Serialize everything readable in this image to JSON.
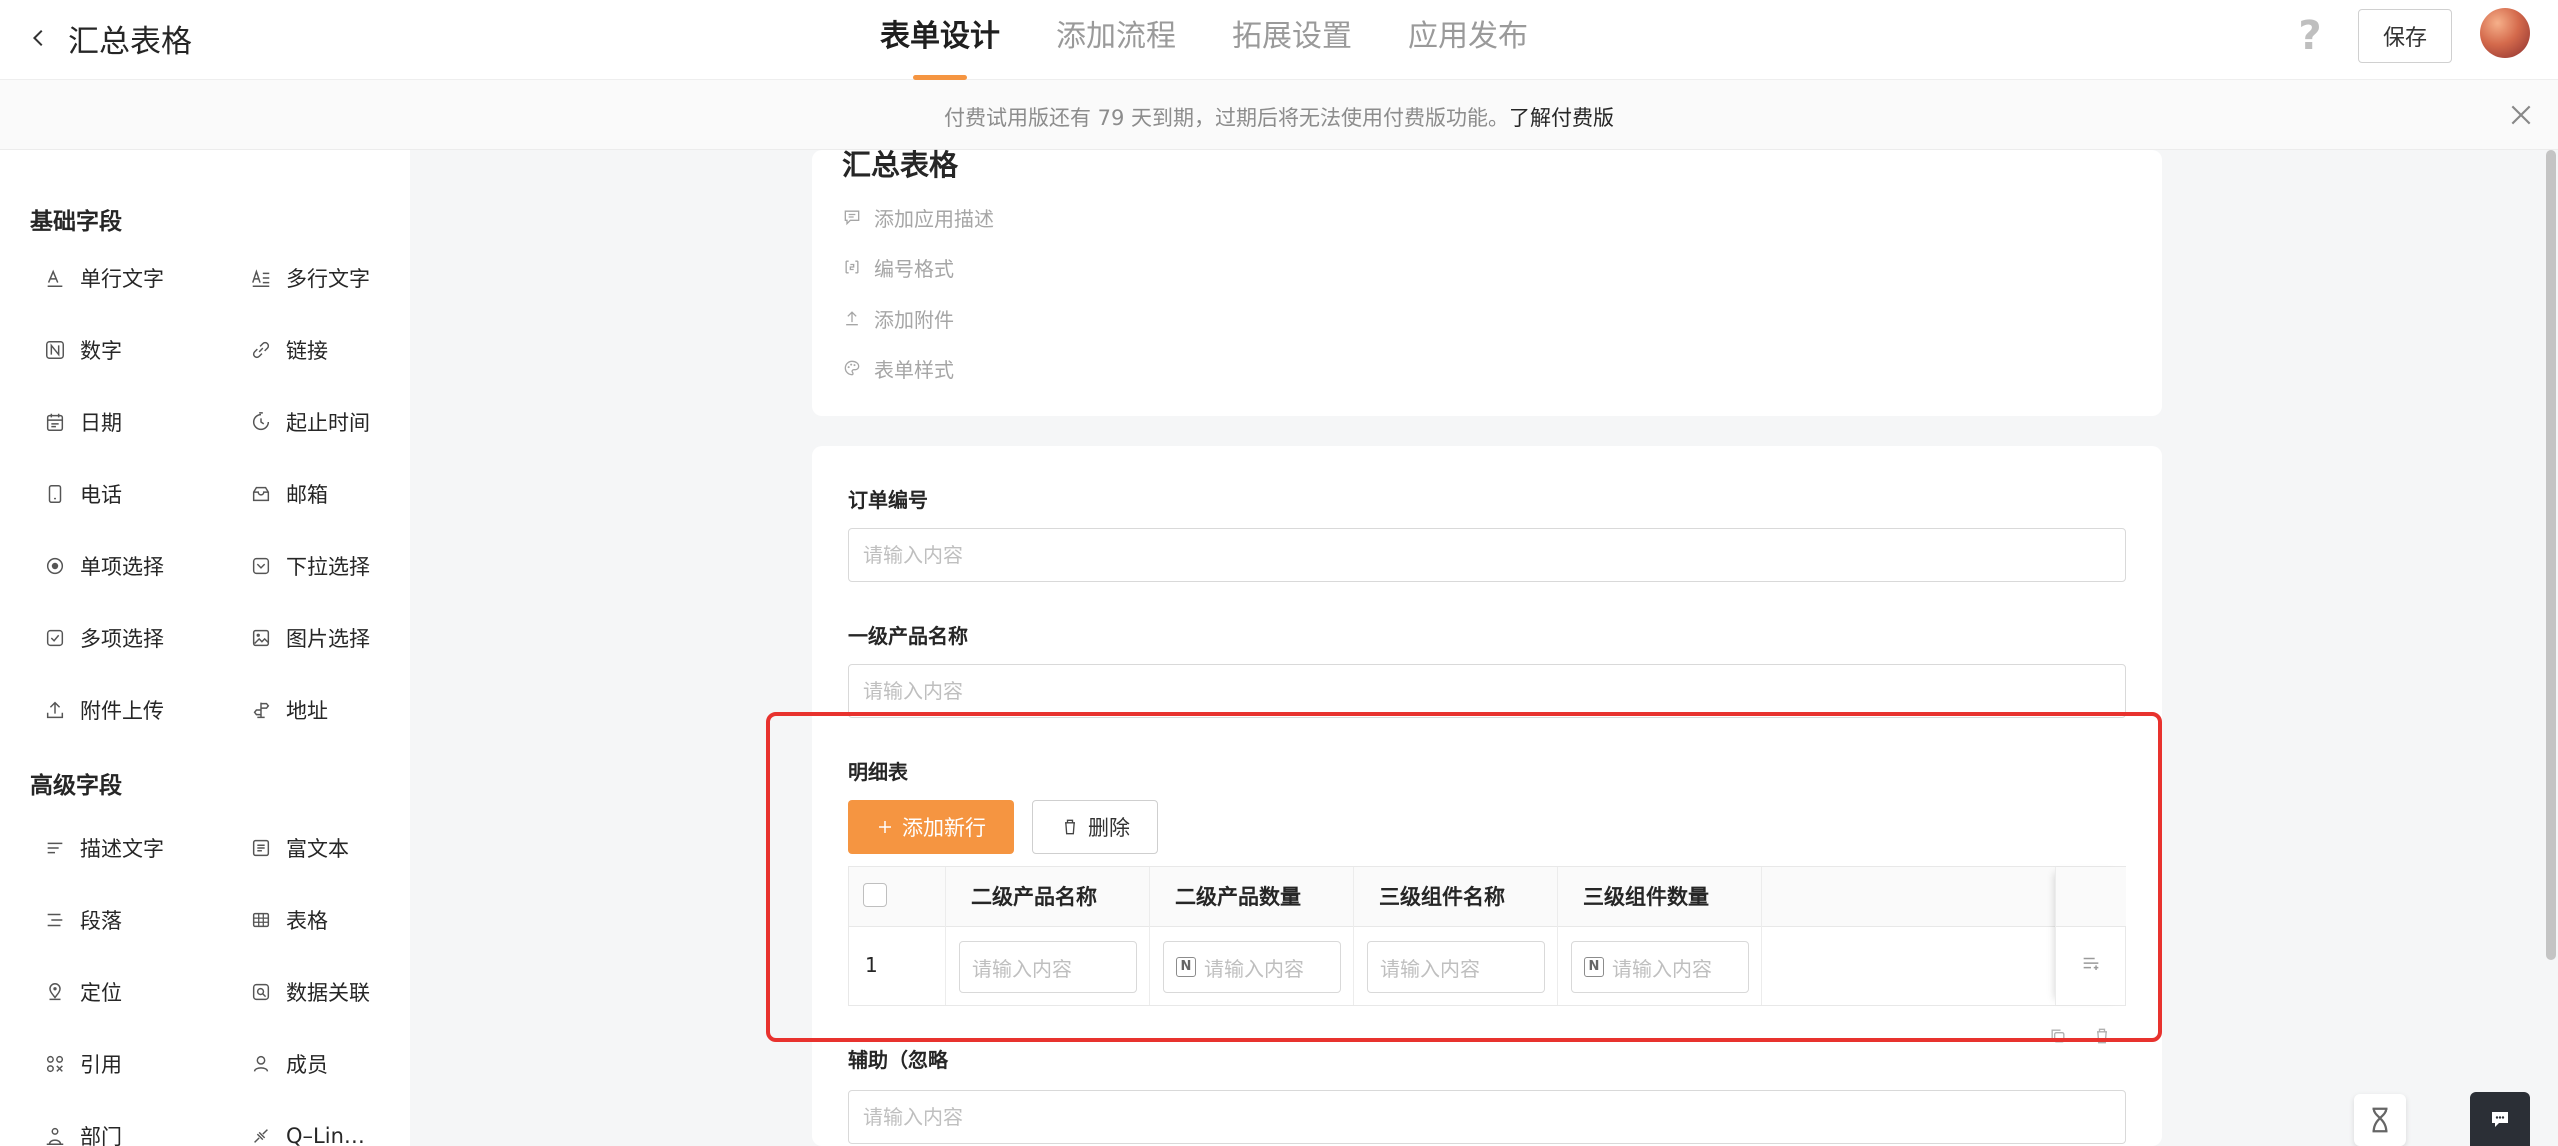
{
  "header": {
    "title": "汇总表格",
    "tabs": [
      {
        "label": "表单设计",
        "active": true
      },
      {
        "label": "添加流程",
        "active": false
      },
      {
        "label": "拓展设置",
        "active": false
      },
      {
        "label": "应用发布",
        "active": false
      }
    ],
    "help": "?",
    "save_label": "保存"
  },
  "notice": {
    "text": "付费试用版还有 79 天到期，过期后将无法使用付费版功能。",
    "link": "了解付费版"
  },
  "sidebar": {
    "basic_title": "基础字段",
    "basic": [
      "单行文字",
      "多行文字",
      "数字",
      "链接",
      "日期",
      "起止时间",
      "电话",
      "邮箱",
      "单项选择",
      "下拉选择",
      "多项选择",
      "图片选择",
      "附件上传",
      "地址"
    ],
    "advanced_title": "高级字段",
    "advanced": [
      "描述文字",
      "富文本",
      "段落",
      "表格",
      "定位",
      "数据关联",
      "引用",
      "成员",
      "部门",
      "Q–Lin…"
    ]
  },
  "form": {
    "title": "汇总表格",
    "meta": [
      "添加应用描述",
      "编号格式",
      "添加附件",
      "表单样式"
    ],
    "fields": [
      {
        "label": "订单编号",
        "placeholder": "请输入内容"
      },
      {
        "label": "一级产品名称",
        "placeholder": "请输入内容"
      }
    ],
    "detail": {
      "label": "明细表",
      "add_row": "添加新行",
      "delete": "删除",
      "columns": [
        "二级产品名称",
        "二级产品数量",
        "三级组件名称",
        "三级组件数量"
      ],
      "row_number": "1",
      "cell_placeholder": "请输入内容",
      "number_badge": "N"
    },
    "aux": {
      "label": "辅助（忽略",
      "placeholder": "请输入内容"
    }
  },
  "colors": {
    "accent": "#f59541",
    "highlight": "#e8322e",
    "muted": "#a6a6a6"
  }
}
